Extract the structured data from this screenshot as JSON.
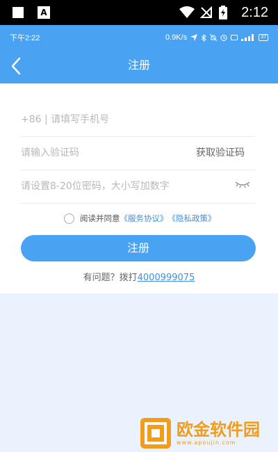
{
  "system_bar": {
    "time": "2:12"
  },
  "inner_status": {
    "time": "下午2:22",
    "speed": "0.9K/s",
    "battery": "37"
  },
  "header": {
    "title": "注册"
  },
  "form": {
    "phone_placeholder": "+86 | 请填写手机号",
    "code_placeholder": "请输入验证码",
    "get_code_label": "获取验证码",
    "password_placeholder": "请设置8-20位密码，大小写加数字",
    "agree_text": "阅读并同意",
    "service_link": "《服务协议》",
    "privacy_link": "《隐私政策》",
    "register_button": "注册",
    "help_text": "有问题？拨打",
    "help_phone": "4000999075"
  },
  "watermark": {
    "title": "欧金软件园",
    "url": "www.apoujin.com"
  },
  "colors": {
    "primary": "#4aa3f2",
    "link": "#3d8fe0",
    "watermark": "#f29b1c"
  }
}
